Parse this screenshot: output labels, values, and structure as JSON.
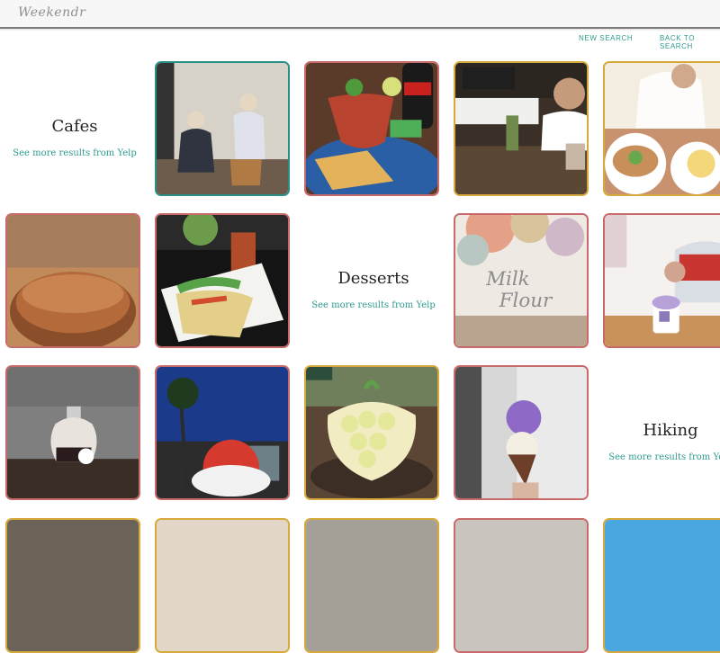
{
  "app": {
    "logo": "Weekendr"
  },
  "nav": {
    "new_search": "NEW SEARCH",
    "back_to_search": "BACK TO SEARCH"
  },
  "categories": [
    {
      "title": "Cafes",
      "link": "See more results from Yelp"
    },
    {
      "title": "Desserts",
      "link": "See more results from Yelp"
    },
    {
      "title": "Hiking",
      "link": "See more results from Yelp"
    }
  ],
  "colors": {
    "accent": "#2e9a8e"
  }
}
